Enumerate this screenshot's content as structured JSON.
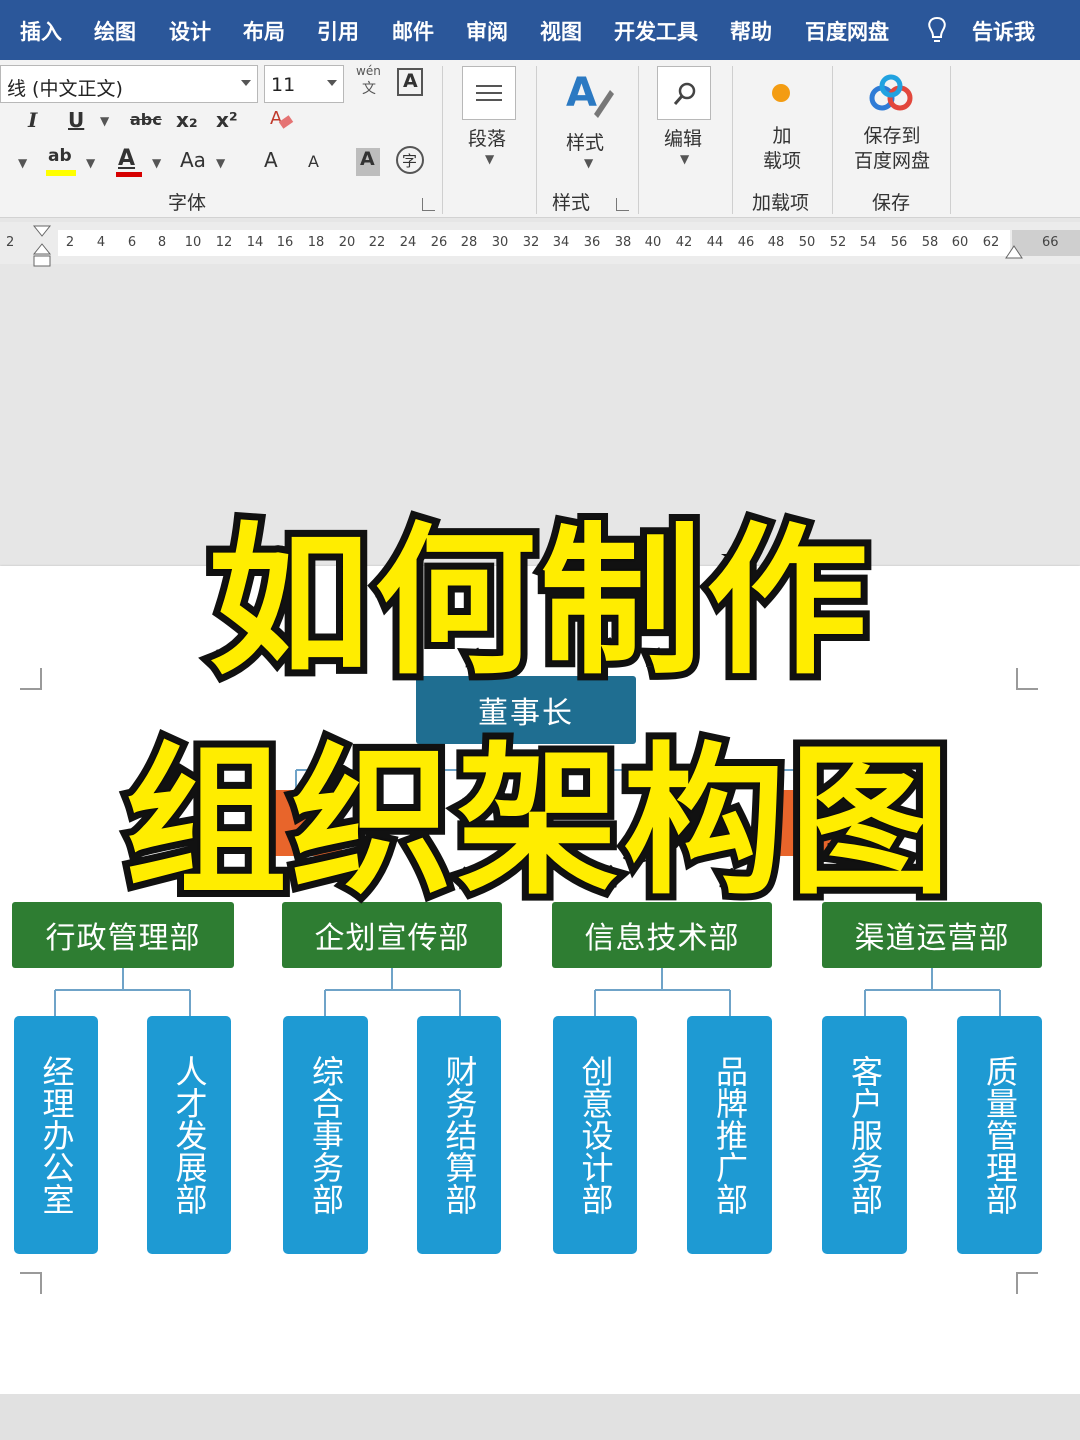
{
  "menu": {
    "items": [
      "插入",
      "绘图",
      "设计",
      "布局",
      "引用",
      "邮件",
      "审阅",
      "视图",
      "开发工具",
      "帮助",
      "百度网盘"
    ],
    "tell_me": "告诉我",
    "accent": "#2b579a"
  },
  "ribbon": {
    "font_name": "线 (中文正文)",
    "font_size": "11",
    "phonetic_top": "wén",
    "phonetic_bottom": "文",
    "font_group_label": "字体",
    "paragraph_label": "段落",
    "styles_button": "样式",
    "styles_group_label": "样式",
    "editing_label": "编辑",
    "addins_button": "加\n载项",
    "addins_group_label": "加载项",
    "save_button": "保存到\n百度网盘",
    "save_group_label": "保存",
    "font_glyphs": {
      "italic": "I",
      "underline": "U",
      "strike": "abc",
      "subscript": "x₂",
      "superscript": "x²",
      "highlight": "ab",
      "font_color": "A",
      "change_case": "Aa",
      "grow": "A",
      "shrink": "A",
      "char_shading": "A",
      "enclose": "字"
    }
  },
  "ruler": {
    "left_label": "2",
    "ticks": [
      "2",
      "4",
      "6",
      "8",
      "10",
      "12",
      "14",
      "16",
      "18",
      "20",
      "22",
      "24",
      "26",
      "28",
      "30",
      "32",
      "34",
      "36",
      "38",
      "40",
      "42",
      "44",
      "46",
      "48",
      "50",
      "52",
      "54",
      "56",
      "58",
      "60",
      "62"
    ],
    "right_label": "66"
  },
  "org_chart": {
    "top": "董事长",
    "departments": [
      {
        "name": "行政管理部",
        "subs": [
          "经理办公室",
          "人才发展部"
        ]
      },
      {
        "name": "企划宣传部",
        "subs": [
          "综合事务部",
          "财务结算部"
        ]
      },
      {
        "name": "信息技术部",
        "subs": [
          "创意设计部",
          "品牌推广部"
        ]
      },
      {
        "name": "渠道运营部",
        "subs": [
          "客户服务部",
          "质量管理部"
        ]
      }
    ],
    "colors": {
      "top": "#1f6e91",
      "mid": "#e8652b",
      "dept": "#2e7d32",
      "sub": "#1e9ad3",
      "line": "#6fa3c8"
    }
  },
  "overlay": {
    "line1": "如何制作",
    "line2": "组织架构图",
    "fill_color": "#ffed00",
    "stroke_color": "#111111"
  }
}
